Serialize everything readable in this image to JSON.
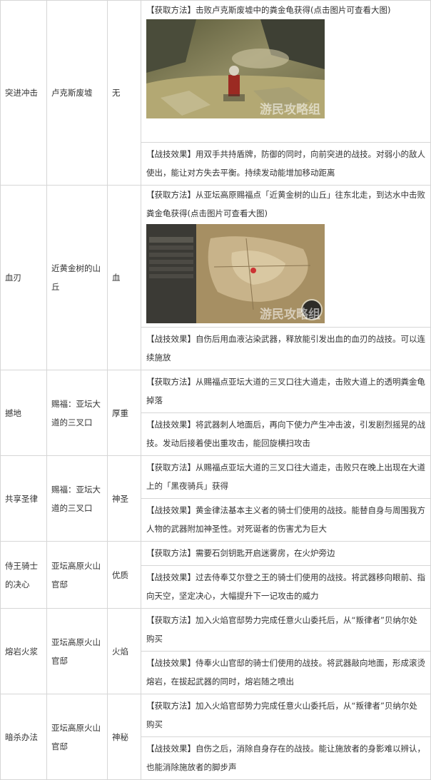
{
  "rows": [
    {
      "name": "突进冲击",
      "location": "卢克斯废墟",
      "affinity": "无",
      "method": "【获取方法】击败卢克斯废墟中的粪金龟获得(点击图片可查看大图)",
      "effect": "【战技效果】用双手共持盾牌，防御的同时，向前突进的战技。对弱小的敌人使出，能让对方失去平衡。持续发动能增加移动距离",
      "image_watermark": "游民攻略组"
    },
    {
      "name": "血刃",
      "location": "近黄金树的山丘",
      "affinity": "血",
      "method": "【获取方法】从亚坛高原赐福点「近黄金树的山丘」往东北走，到达水中击败粪金龟获得(点击图片可查看大图)",
      "effect": "【战技效果】自伤后用血液沾染武器，释放能引发出血的血刃的战技。可以连续施放",
      "image_watermark": "游民攻略组"
    },
    {
      "name": "撼地",
      "location": "赐福：亚坛大道的三叉口",
      "affinity": "厚重",
      "method": "【获取方法】从赐福点亚坛大道的三叉口往大道走，击败大道上的透明粪金龟掉落",
      "effect": "【战技效果】将武器刺人地面后，再向下使力产生冲击波，引发剧烈摇晃的战技。发动后接着使出重攻击，能回旋横扫攻击"
    },
    {
      "name": "共享圣律",
      "location": "赐福：亚坛大道的三叉口",
      "affinity": "神圣",
      "method": "【获取方法】从赐福点亚坛大道的三叉口往大道走，击败只在晚上出现在大道上的「黑夜骑兵」获得",
      "effect": "【战技效果】黄金律法基本主义者的骑士们使用的战技。能替自身与周围我方人物的武器附加神圣性。对死诞者的伤害尤为巨大"
    },
    {
      "name": "侍王骑士的决心",
      "location": "亚坛高原火山官邸",
      "affinity": "优质",
      "method": "【获取方法】需要石剑钥匙开启迷雾房，在火炉旁边",
      "effect": "【战技效果】过去侍奉艾尔登之王的骑士们使用的战技。将武器移向眼前、指向天空，坚定决心，大幅提升下一记攻击的威力"
    },
    {
      "name": "熔岩火浆",
      "location": "亚坛高原火山官邸",
      "affinity": "火焰",
      "method": "【获取方法】加入火焰官邸势力完成任意火山委托后，从“叛律者”贝纳尔处购买",
      "effect": "【战技效果】侍奉火山官邸的骑士们使用的战技。将武器敲向地面，形成滚烫熔岩，在拔起武器的同时，熔岩随之喷出"
    },
    {
      "name": "暗杀办法",
      "location": "亚坛高原火山官邸",
      "affinity": "神秘",
      "method": "【获取方法】加入火焰官邸势力完成任意火山委托后，从“叛律者”贝纳尔处购买",
      "effect": "【战技效果】自伤之后，消除自身存在的战技。能让施放者的身影难以辨认，也能消除施放者的脚步声"
    }
  ],
  "colors": {
    "border": "#d6d6d6",
    "text": "#333333"
  }
}
